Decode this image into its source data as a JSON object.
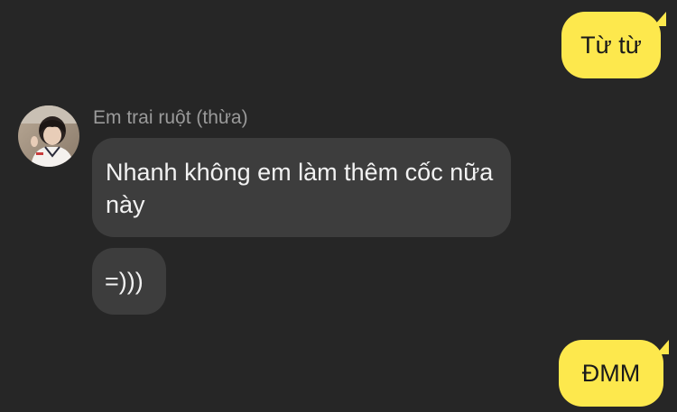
{
  "outgoing_messages": [
    {
      "text": "Từ từ"
    },
    {
      "text": "ĐMM"
    }
  ],
  "contact": {
    "name": "Em trai ruột (thừa)"
  },
  "incoming_messages": [
    {
      "text": "Nhanh không em làm thêm cốc nữa này"
    },
    {
      "text": "=)))"
    }
  ],
  "colors": {
    "background": "#262626",
    "outgoing_bubble": "#fde84d",
    "incoming_bubble": "#3d3d3d",
    "sender_name": "#9a9a9a"
  }
}
